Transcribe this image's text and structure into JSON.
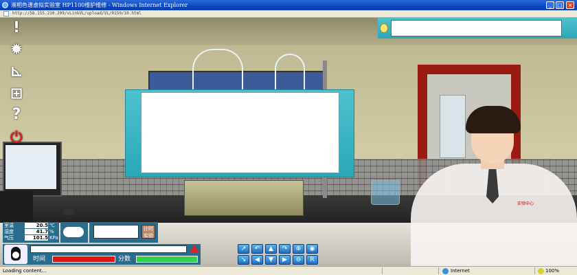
{
  "window": {
    "title": "液相色谱虚拟实验室 HP1100维护维修 - Windows Internet Explorer",
    "url": "http://58.155.210.209/vLinkVL/upload/VL/0150/10.html"
  },
  "environment": {
    "rows": [
      {
        "label": "室温",
        "value": "20.5",
        "unit": "℃"
      },
      {
        "label": "湿度",
        "value": "41.7",
        "unit": "%"
      },
      {
        "label": "气压",
        "value": "101.5",
        "unit": "KPa"
      }
    ]
  },
  "timer": {
    "button_label": "计时实验"
  },
  "progress": {
    "time_label": "时间",
    "score_label": "分数"
  },
  "badge": {
    "text": "实验中心"
  },
  "statusbar": {
    "status": "Loading content...",
    "zone": "Internet",
    "zoom": "100%"
  },
  "colors": {
    "panel": "#2a6c8c",
    "dialog": "#2aa7b8",
    "time_bar": "#e01616",
    "score_bar": "#33d04a"
  }
}
